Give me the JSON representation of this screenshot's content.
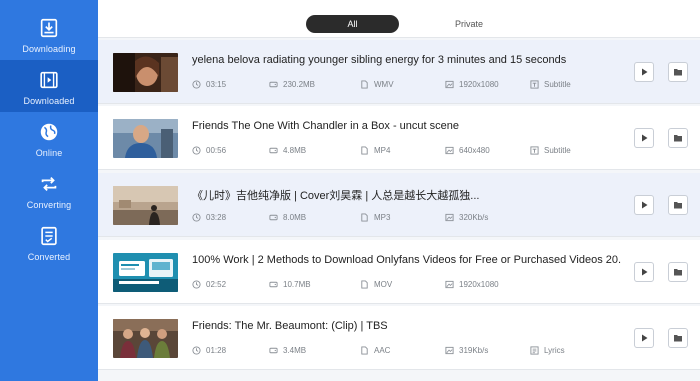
{
  "sidebar": {
    "items": [
      {
        "label": "Downloading",
        "icon": "download-tray-icon",
        "active": false
      },
      {
        "label": "Downloaded",
        "icon": "film-icon",
        "active": true
      },
      {
        "label": "Online",
        "icon": "globe-icon",
        "active": false
      },
      {
        "label": "Converting",
        "icon": "convert-arrows-icon",
        "active": false
      },
      {
        "label": "Converted",
        "icon": "converted-document-icon",
        "active": false
      }
    ],
    "accent_color": "#2f78e0",
    "active_color": "#1b5fc4"
  },
  "tabs": {
    "all": "All",
    "private": "Private",
    "selected": "All"
  },
  "videos": [
    {
      "title": "yelena belova radiating younger sibling energy for 3 minutes and 15 seconds",
      "duration": "03:15",
      "size": "230.2MB",
      "format": "WMV",
      "quality": "1920x1080",
      "extra": "Subtitle",
      "highlighted": true
    },
    {
      "title": "Friends  The One With Chandler in a Box - uncut scene",
      "duration": "00:56",
      "size": "4.8MB",
      "format": "MP4",
      "quality": "640x480",
      "extra": "Subtitle",
      "highlighted": false
    },
    {
      "title": "《儿时》吉他纯净版 | Cover刘昊霖 | 人总是越长大越孤独...",
      "duration": "03:28",
      "size": "8.0MB",
      "format": "MP3",
      "quality": "320Kb/s",
      "extra": "",
      "highlighted": true
    },
    {
      "title": "100% Work | 2 Methods to Download Onlyfans Videos for Free or Purchased Videos 20.",
      "duration": "02:52",
      "size": "10.7MB",
      "format": "MOV",
      "quality": "1920x1080",
      "extra": "",
      "highlighted": false
    },
    {
      "title": "Friends: The Mr. Beaumont: (Clip) | TBS",
      "duration": "01:28",
      "size": "3.4MB",
      "format": "AAC",
      "quality": "319Kb/s",
      "extra": "Lyrics",
      "highlighted": false
    }
  ]
}
